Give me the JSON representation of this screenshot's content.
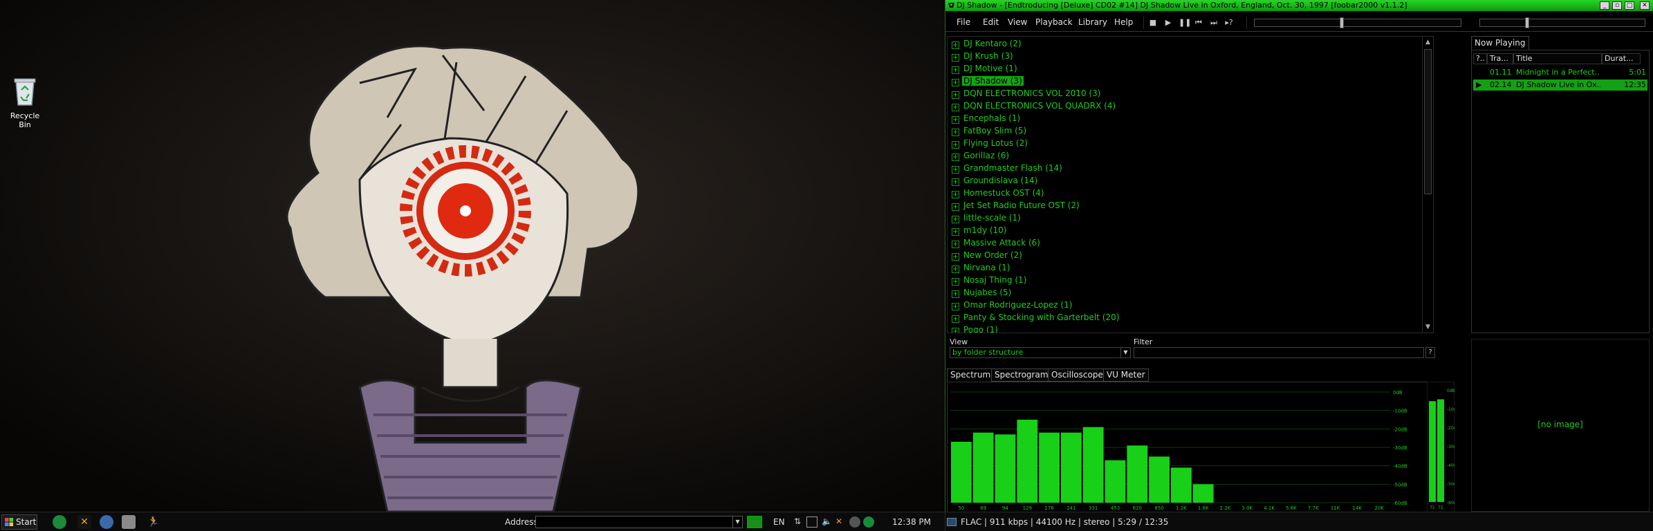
{
  "desktop": {
    "icons": [
      {
        "label": "Recycle Bin",
        "icon": "recycle-bin-icon"
      }
    ]
  },
  "window": {
    "title": "DJ Shadow - [Endtroducing [Deluxe] CD02 #14] DJ Shadow Live in Oxford, England, Oct. 30, 1997  [foobar2000 v1.1.2]",
    "buttons": [
      "minimize",
      "maximize",
      "close"
    ]
  },
  "menu": [
    "File",
    "Edit",
    "View",
    "Playback",
    "Library",
    "Help"
  ],
  "controls": [
    {
      "name": "stop",
      "glyph": "■"
    },
    {
      "name": "play",
      "glyph": "▶"
    },
    {
      "name": "pause",
      "glyph": "❚❚"
    },
    {
      "name": "previous",
      "glyph": "⏮"
    },
    {
      "name": "next",
      "glyph": "⏭"
    },
    {
      "name": "random",
      "glyph": "▸?"
    }
  ],
  "seek_position": 0.42,
  "volume_position": 0.28,
  "library": {
    "items": [
      {
        "label": "DJ Kentaro (2)"
      },
      {
        "label": "DJ Krush (3)"
      },
      {
        "label": "DJ Motive (1)"
      },
      {
        "label": "DJ Shadow (3)",
        "selected": true
      },
      {
        "label": "DQN ELECTRONICS VOL 2010 (3)"
      },
      {
        "label": "DQN ELECTRONICS VOL QUADRX (4)"
      },
      {
        "label": "Encephals (1)"
      },
      {
        "label": "FatBoy Slim (5)"
      },
      {
        "label": "Flying Lotus (2)"
      },
      {
        "label": "Gorillaz (6)"
      },
      {
        "label": "Grandmaster Flash (14)"
      },
      {
        "label": "Groundislava (14)"
      },
      {
        "label": "Homestuck OST (4)"
      },
      {
        "label": "Jet Set Radio Future OST (2)"
      },
      {
        "label": "little-scale (1)"
      },
      {
        "label": "m1dy (10)"
      },
      {
        "label": "Massive Attack (6)"
      },
      {
        "label": "New Order (2)"
      },
      {
        "label": "Nirvana (1)"
      },
      {
        "label": "Nosaj Thing (1)"
      },
      {
        "label": "Nujabes (5)"
      },
      {
        "label": "Omar Rodriguez-Lopez (1)"
      },
      {
        "label": "Panty & Stocking with Garterbelt (20)"
      },
      {
        "label": "Pogo (1)"
      }
    ]
  },
  "view": {
    "label": "View",
    "value": "by folder structure"
  },
  "filter": {
    "label": "Filter",
    "value": "",
    "help": "?"
  },
  "viz_tabs": [
    "Spectrum",
    "Spectrogram",
    "Oscilloscope",
    "VU Meter"
  ],
  "now_playing": {
    "tab": "Now Playing",
    "columns": [
      "?..",
      "Tra...",
      "Title",
      "Durat..."
    ],
    "rows": [
      {
        "status": "",
        "track": "01.11",
        "title": "Midnight in a Perfect...",
        "duration": "5:01",
        "selected": false
      },
      {
        "status": "▶",
        "track": "02.14",
        "title": "DJ Shadow Live in Ox...",
        "duration": "12:35",
        "selected": true
      }
    ]
  },
  "album_art": {
    "placeholder": "[no image]"
  },
  "chart_data": [
    {
      "type": "bar",
      "title": "",
      "categories": [
        "50",
        "69",
        "94",
        "129",
        "176",
        "241",
        "331",
        "453",
        "620",
        "850",
        "1.2K",
        "1.6K",
        "2.2K",
        "3.0K",
        "4.1K",
        "5.6K",
        "7.7K",
        "11K",
        "14K",
        "20K"
      ],
      "values": [
        -27,
        -22,
        -23,
        -15,
        -22,
        -22,
        -19,
        -37,
        -29,
        -35,
        -41,
        -50,
        -60,
        -60,
        -60,
        -60,
        -60,
        -60,
        -60,
        -60
      ],
      "ylim": [
        -60,
        0
      ],
      "yticks": [
        "0dB",
        "-10dB",
        "-20dB",
        "-30dB",
        "-40dB",
        "-50dB",
        "-60dB"
      ],
      "grid": true,
      "color": "#18d018"
    },
    {
      "type": "bar",
      "title": "",
      "categories": [
        "T1",
        "T2"
      ],
      "values": [
        -6,
        -5
      ],
      "ylim": [
        -60,
        0
      ],
      "yticks": [
        "0dB",
        "-10dB",
        "-20dB",
        "-30dB",
        "-40dB",
        "-50dB",
        "-60dB"
      ],
      "color": "#18d018"
    }
  ],
  "taskbar": {
    "start_label": "Start",
    "address_label": "Address",
    "address_value": "",
    "lang": "EN",
    "clock": "12:38 PM",
    "quick_launch": [
      "utorrent-icon",
      "foobar-icon",
      "browser-icon",
      "download-icon",
      "runner-icon"
    ],
    "tray_icons": [
      "arrow-icon",
      "monitor-icon",
      "speaker-icon",
      "foobar-tray-icon",
      "steam-icon",
      "utorrent-tray-icon"
    ]
  },
  "status": "FLAC | 911 kbps | 44100 Hz | stereo | 5:29 / 12:35"
}
